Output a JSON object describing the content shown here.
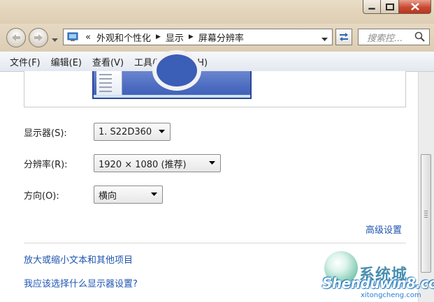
{
  "window": {
    "minimize_icon": "minimize-icon",
    "maximize_icon": "maximize-icon",
    "close_icon": "close-icon"
  },
  "address_bar": {
    "overflow": "«",
    "breadcrumbs": [
      {
        "label": "外观和个性化"
      },
      {
        "label": "显示"
      },
      {
        "label": "屏幕分辨率"
      }
    ],
    "search_placeholder": "搜索控..."
  },
  "menu": {
    "items": [
      {
        "label": "文件(F)"
      },
      {
        "label": "编辑(E)"
      },
      {
        "label": "查看(V)"
      },
      {
        "label": "工具(T)"
      },
      {
        "label": "帮助(H)"
      }
    ]
  },
  "settings": {
    "display_label": "显示器(S):",
    "display_value": "1. S22D360",
    "resolution_label": "分辨率(R):",
    "resolution_value": "1920 × 1080 (推荐)",
    "orientation_label": "方向(O):",
    "orientation_value": "横向"
  },
  "links": {
    "advanced": "高级设置",
    "text_size": "放大或缩小文本和其他项目",
    "which_settings": "我应该选择什么显示器设置?"
  },
  "watermark": {
    "cn": "系统城",
    "en": "Shenduwin8.com",
    "sub": "xitongcheng.com"
  },
  "colors": {
    "link": "#1f55b1",
    "chrome": "#e3d4bb",
    "menubar": "#e9edf3",
    "close": "#c94a33"
  }
}
